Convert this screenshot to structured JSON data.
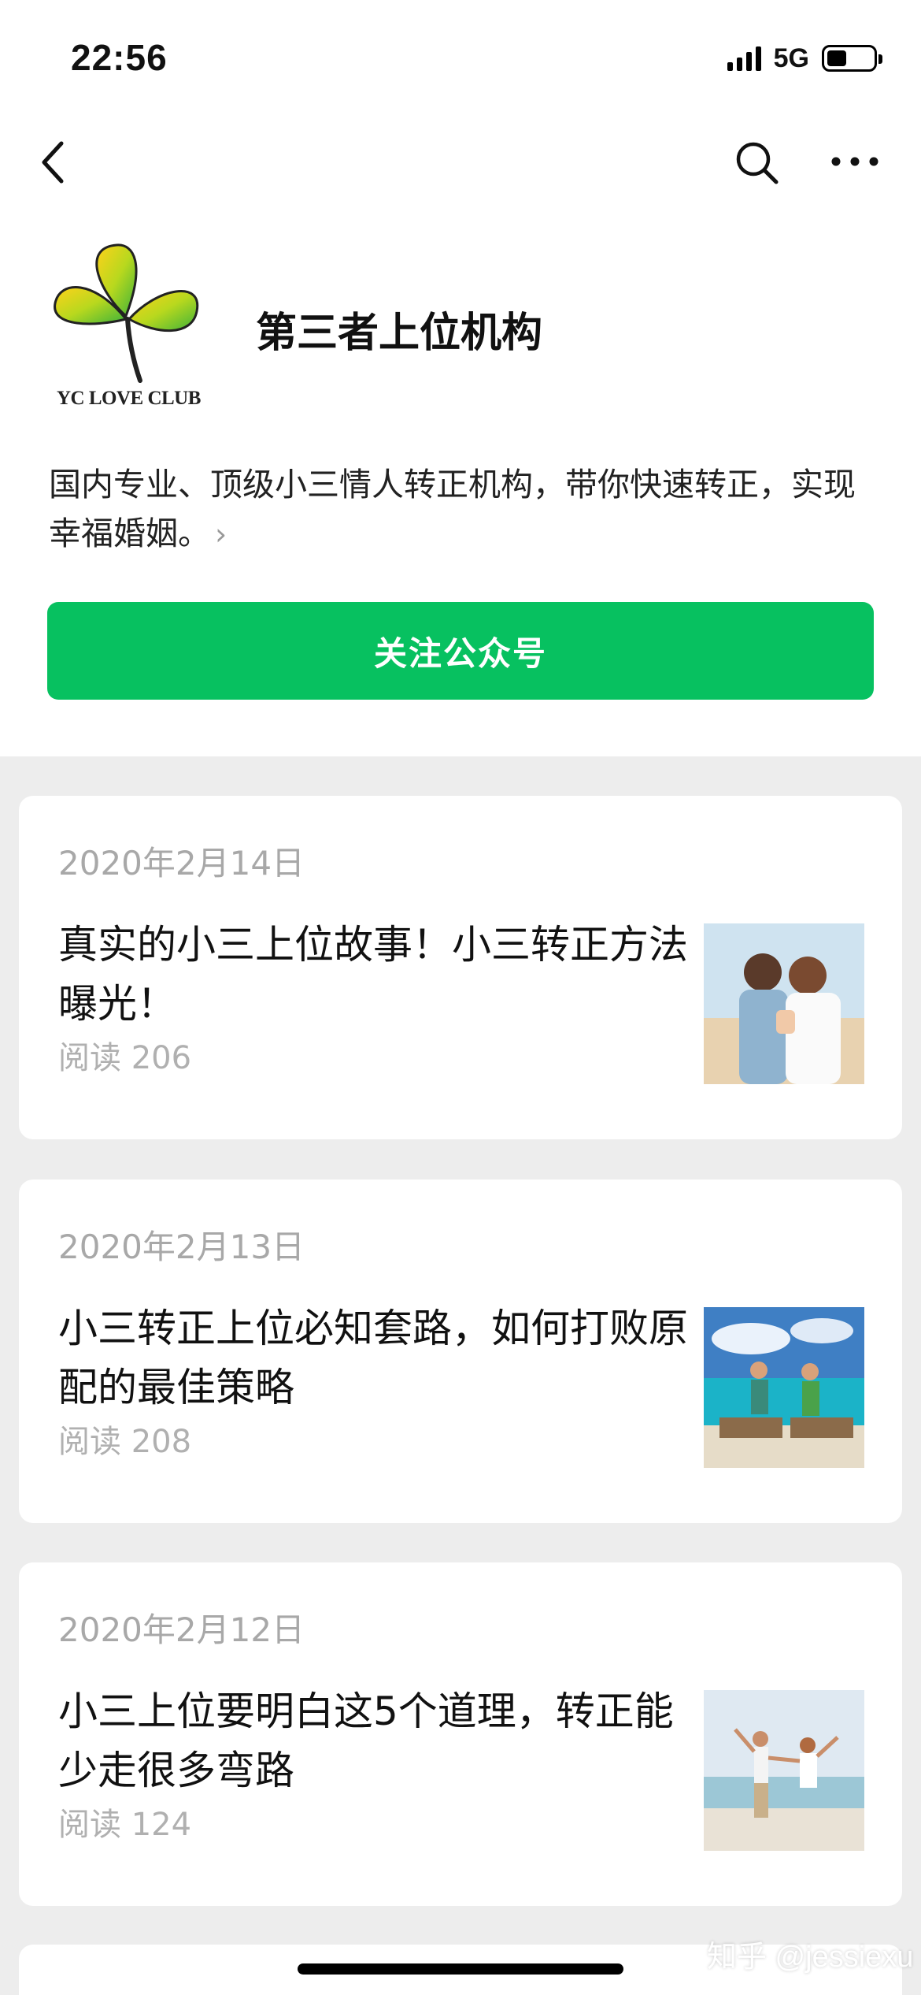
{
  "status_bar": {
    "time": "22:56",
    "network": "5G",
    "signal_bars": 4,
    "battery_level": 0.42
  },
  "nav": {
    "back_icon": "chevron-left-icon",
    "search_icon": "search-icon",
    "more_icon": "more-icon"
  },
  "profile": {
    "logo_text": "YC LOVE CLUB",
    "name": "第三者上位机构",
    "description": "国内专业、顶级小三情人转正机构，带你快速转正，实现幸福婚姻。",
    "description_arrow": "›",
    "follow_label": "关注公众号"
  },
  "articles": [
    {
      "date": "2020年2月14日",
      "title": "真实的小三上位故事！小三转正方法曝光！",
      "reads": "阅读 206",
      "thumb": "couple-photo"
    },
    {
      "date": "2020年2月13日",
      "title": "小三转正上位必知套路，如何打败原配的最佳策略",
      "reads": "阅读 208",
      "thumb": "beach-couple-photo"
    },
    {
      "date": "2020年2月12日",
      "title": "小三上位要明白这5个道理，转正能少走很多弯路",
      "reads": "阅读 124",
      "thumb": "jumping-couple-photo"
    }
  ],
  "watermark": "知乎 @jessiexu",
  "colors": {
    "accent": "#07c160",
    "background": "#ededed",
    "muted": "#a8a8a8"
  }
}
